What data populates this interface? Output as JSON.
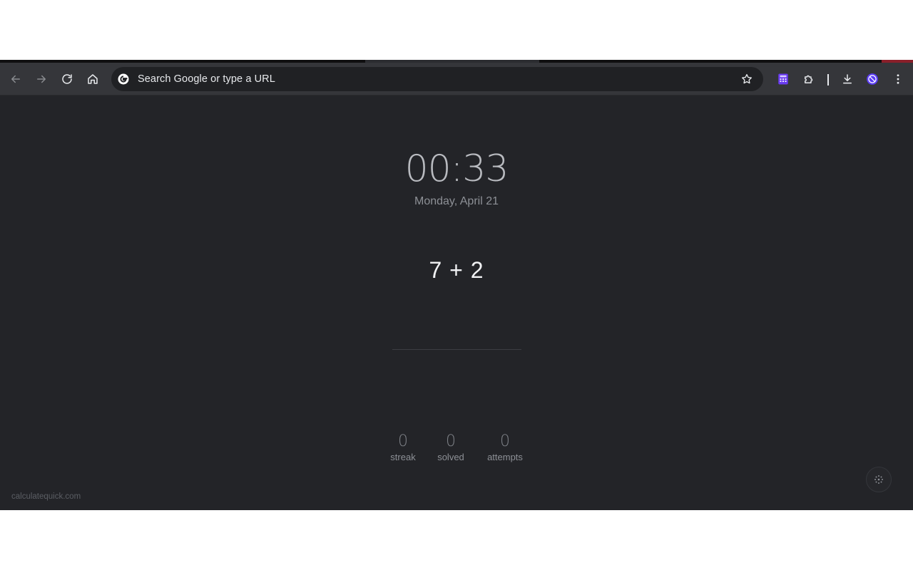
{
  "browser": {
    "omnibox": {
      "placeholder": "Search Google or type a URL"
    },
    "icons": {
      "back": "arrow-left-icon",
      "forward": "arrow-right-icon",
      "reload": "reload-icon",
      "home": "home-icon",
      "google": "google-g-icon",
      "bookmark": "star-icon",
      "calculator_extension": "calculator-icon",
      "extensions": "puzzle-icon",
      "downloads": "download-icon",
      "profile": "profile-avatar-icon",
      "menu": "kebab-menu-icon"
    },
    "colors": {
      "extension_accent": "#6a3bf2",
      "profile_accent": "#5b3df5"
    }
  },
  "page": {
    "clock": "00:33",
    "date": "Monday, April 21",
    "problem": "7 + 2",
    "answer": "",
    "stats": [
      {
        "value": "0",
        "label": "streak"
      },
      {
        "value": "0",
        "label": "solved"
      },
      {
        "value": "0",
        "label": "attempts"
      }
    ],
    "brand": "calculatequick.com",
    "settings_icon": "settings-dots-icon"
  }
}
